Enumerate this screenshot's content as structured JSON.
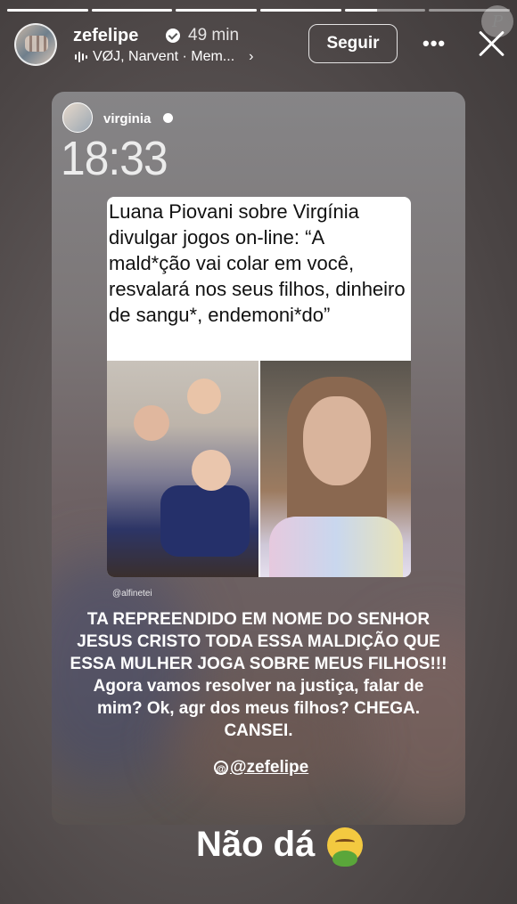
{
  "progress": {
    "segments": [
      1,
      1,
      1,
      1,
      0.4,
      0
    ],
    "active_index": 4
  },
  "header": {
    "username": "zefelipe",
    "time_ago": "49 min",
    "music": "VØJ, Narvent · Mem...",
    "follow_label": "Seguir",
    "more_label": "•••"
  },
  "watermark": "P",
  "post": {
    "username": "virginia",
    "clock": "18:33",
    "headline": "Luana Piovani sobre Virgínia divulgar jogos on-line: “A mald*ção vai colar em você, resvalará nos seus filhos, dinheiro de sangu*, endemoni*do”",
    "credit": "@alfinetei",
    "caption_upper": "TA REPREENDIDO EM NOME DO SENHOR JESUS CRISTO TODA ESSA MALDIÇÃO QUE ESSA MULHER JOGA SOBRE MEUS FILHOS!!!",
    "caption_rest": "Agora vamos resolver na justiça, falar de mim? Ok, agr dos meus filhos? CHEGA. CANSEI.",
    "mention": "@zefelipe",
    "threads_symbol": "@"
  },
  "bottom_text": "Não dá",
  "emoji_name": "nauseated-face-emoji"
}
